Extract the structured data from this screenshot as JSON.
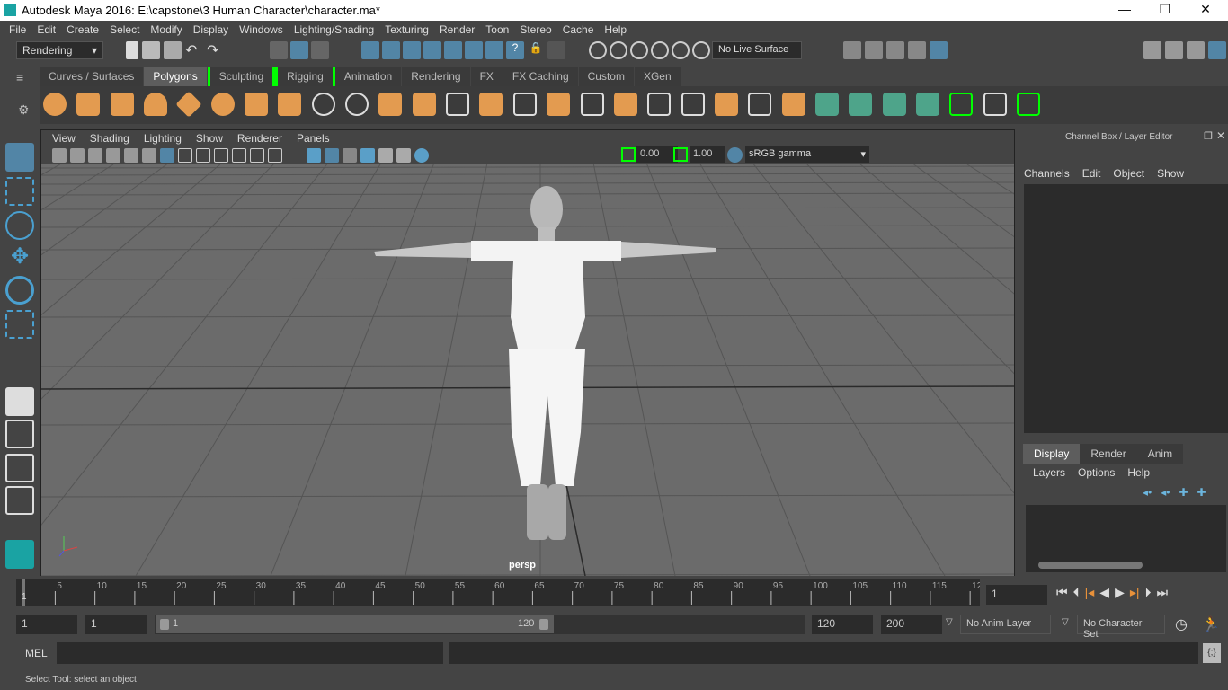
{
  "window": {
    "title": "Autodesk Maya 2016: E:\\capstone\\3 Human Character\\character.ma*",
    "controls": [
      "—",
      "❐",
      "✕"
    ]
  },
  "menubar": [
    "File",
    "Edit",
    "Create",
    "Select",
    "Modify",
    "Display",
    "Windows",
    "Lighting/Shading",
    "Texturing",
    "Render",
    "Toon",
    "Stereo",
    "Cache",
    "Help"
  ],
  "status": {
    "menuset": "Rendering",
    "live_surface": "No Live Surface"
  },
  "shelf": {
    "tabs": [
      "Curves / Surfaces",
      "Polygons",
      "Sculpting",
      "Rigging",
      "Animation",
      "Rendering",
      "FX",
      "FX Caching",
      "Custom",
      "XGen"
    ],
    "active": "Polygons"
  },
  "viewport": {
    "menu": [
      "View",
      "Shading",
      "Lighting",
      "Show",
      "Renderer",
      "Panels"
    ],
    "exposure": "0.00",
    "gamma": "1.00",
    "color_space": "sRGB gamma",
    "camera": "persp"
  },
  "channel_box": {
    "title": "Channel Box / Layer Editor",
    "menu": [
      "Channels",
      "Edit",
      "Object",
      "Show"
    ],
    "layer_tabs": [
      "Display",
      "Render",
      "Anim"
    ],
    "active_layer_tab": "Display",
    "layer_menu": [
      "Layers",
      "Options",
      "Help"
    ]
  },
  "timeline": {
    "ticks": [
      "5",
      "10",
      "15",
      "20",
      "25",
      "30",
      "35",
      "40",
      "45",
      "50",
      "55",
      "60",
      "65",
      "70",
      "75",
      "80",
      "85",
      "90",
      "95",
      "100",
      "105",
      "110",
      "115",
      "12"
    ],
    "start_marker": "1",
    "current_frame": "1"
  },
  "range": {
    "start": "1",
    "playback_start": "1",
    "slider_start": "1",
    "slider_end": "120",
    "playback_end": "120",
    "end": "200",
    "anim_layer": "No Anim Layer",
    "character_set": "No Character Set"
  },
  "command": {
    "label": "MEL"
  },
  "help_line": "Select Tool: select an object",
  "colors": {
    "accent_blue": "#5285a6",
    "shelf_orange": "#e39b50",
    "viewport_bg": "#6b6b6b"
  }
}
